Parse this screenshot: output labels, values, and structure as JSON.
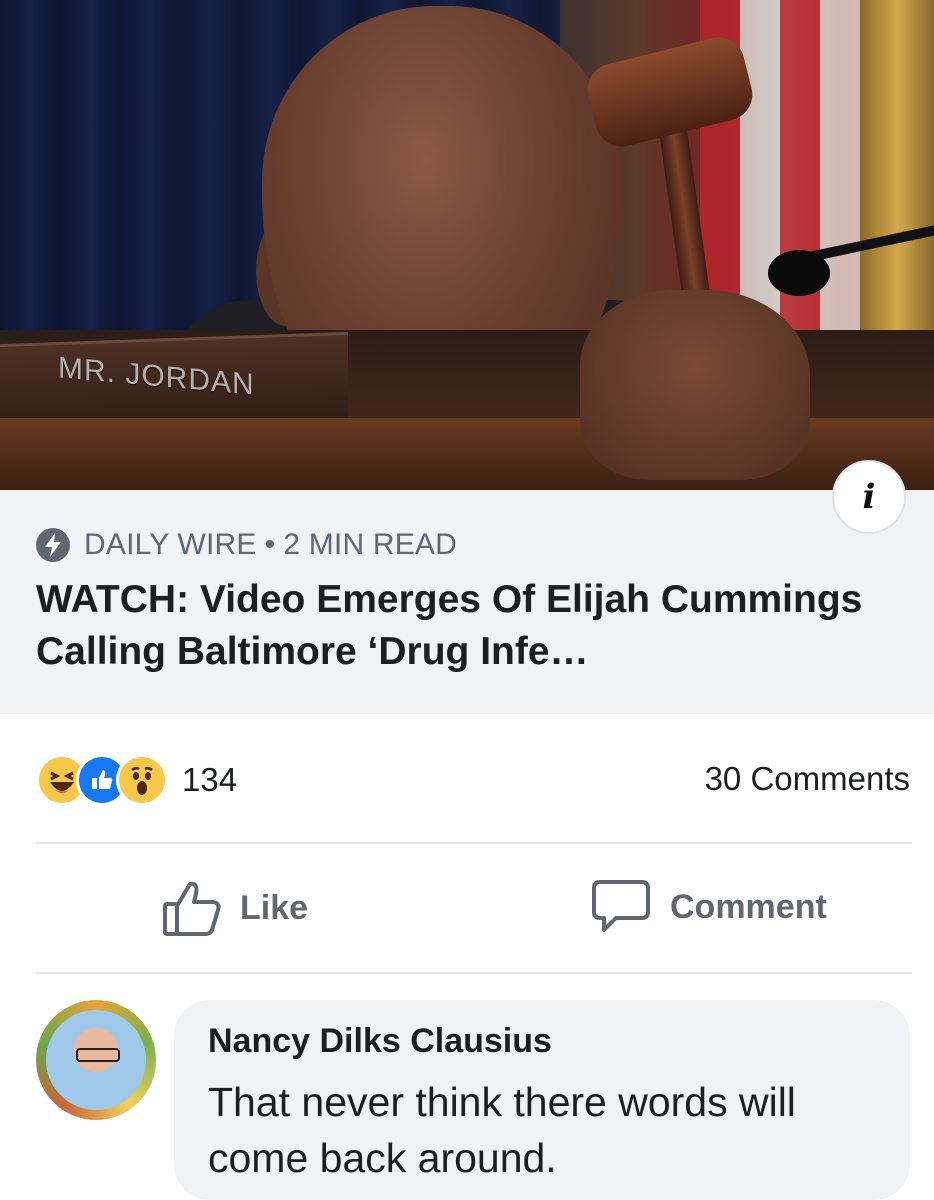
{
  "photo": {
    "nameplate_text": "MR. JORDAN",
    "info_icon": "info-icon"
  },
  "link_preview": {
    "source": "DAILY WIRE",
    "separator": "•",
    "read_time": "2 MIN READ",
    "headline": "WATCH: Video Emerges Of Elijah Cummings Calling Baltimore ‘Drug Infe…",
    "source_icon": "lightning-bolt-icon"
  },
  "reactions": {
    "icons": [
      "haha-emoji-icon",
      "like-thumb-icon",
      "wow-emoji-icon"
    ],
    "count": "134",
    "comments": "30 Comments"
  },
  "actions": {
    "like_label": "Like",
    "comment_label": "Comment"
  },
  "comment": {
    "author": "Nancy Dilks Clausius",
    "text": "That never think there  words will come back around."
  },
  "colors": {
    "link_box_bg": "#f0f2f5",
    "secondary_text": "#606770",
    "like_blue": "#1877f2",
    "emoji_yellow": "#f7c84a"
  }
}
